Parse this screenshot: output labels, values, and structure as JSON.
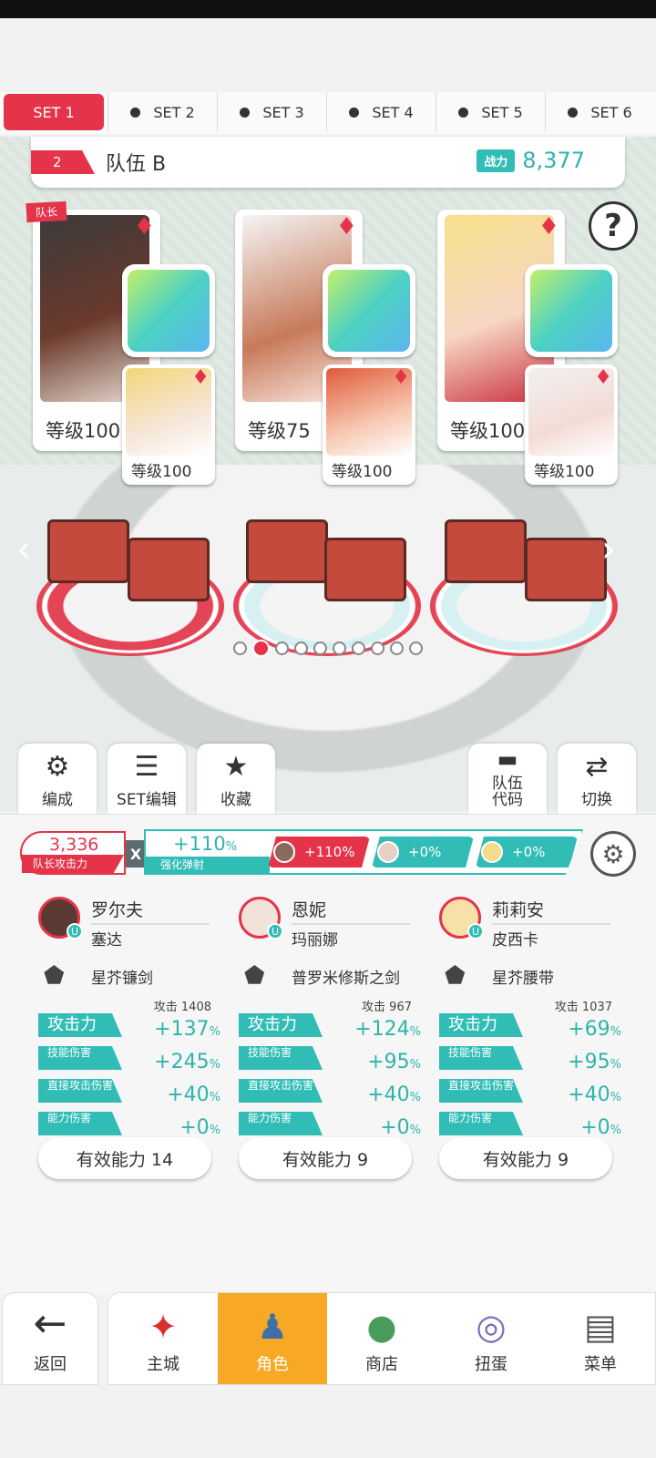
{
  "set_tabs": [
    {
      "label": "SET 1",
      "active": true
    },
    {
      "label": "SET 2",
      "active": false
    },
    {
      "label": "SET 3",
      "active": false
    },
    {
      "label": "SET 4",
      "active": false
    },
    {
      "label": "SET 5",
      "active": false
    },
    {
      "label": "SET 6",
      "active": false
    }
  ],
  "team": {
    "number": "2",
    "name": "队伍 B",
    "power_label": "战力",
    "power_value": "8,377"
  },
  "help_glyph": "?",
  "leader_label": "队长",
  "cards": [
    {
      "level": "等级100",
      "sub_level": "等级100"
    },
    {
      "level": "等级75",
      "sub_level": "等级100"
    },
    {
      "level": "等级100",
      "sub_level": "等级100"
    }
  ],
  "page_dots": {
    "total": 10,
    "active_index": 1
  },
  "side_buttons": [
    {
      "label": "编成",
      "icon": "person-gear-icon"
    },
    {
      "label": "SET编辑",
      "icon": "list-icon"
    },
    {
      "label": "收藏",
      "icon": "thumbs-up-star-icon"
    },
    {
      "label": "队伍\n代码",
      "icon": "chat-bubble-icon"
    },
    {
      "label": "切换",
      "icon": "swap-icon"
    }
  ],
  "leader_attack": {
    "value": "3,336",
    "label": "队长攻击力"
  },
  "multiplier": "X",
  "boost": {
    "value": "+110",
    "unit": "%",
    "label": "强化弹射"
  },
  "chips": [
    {
      "value": "+110%",
      "color": "#e5344a"
    },
    {
      "value": "+0%",
      "color": "#31bdb6"
    },
    {
      "value": "+0%",
      "color": "#31bdb6"
    }
  ],
  "heroes": [
    {
      "name": "罗尔夫",
      "sub": "塞达",
      "weapon": "星芥镰剑",
      "attack_raw": "攻击 1408",
      "stats": [
        {
          "label": "攻击力",
          "value": "+137",
          "unit": "%"
        },
        {
          "label": "技能伤害",
          "value": "+245",
          "unit": "%"
        },
        {
          "label": "直接攻击伤害",
          "value": "+40",
          "unit": "%"
        },
        {
          "label": "能力伤害",
          "value": "+0",
          "unit": "%"
        }
      ],
      "effective": "有效能力 14"
    },
    {
      "name": "恩妮",
      "sub": "玛丽娜",
      "weapon": "普罗米修斯之剑",
      "attack_raw": "攻击  967",
      "stats": [
        {
          "label": "攻击力",
          "value": "+124",
          "unit": "%"
        },
        {
          "label": "技能伤害",
          "value": "+95",
          "unit": "%"
        },
        {
          "label": "直接攻击伤害",
          "value": "+40",
          "unit": "%"
        },
        {
          "label": "能力伤害",
          "value": "+0",
          "unit": "%"
        }
      ],
      "effective": "有效能力 9"
    },
    {
      "name": "莉莉安",
      "sub": "皮西卡",
      "weapon": "星芥腰带",
      "attack_raw": "攻击 1037",
      "stats": [
        {
          "label": "攻击力",
          "value": "+69",
          "unit": "%"
        },
        {
          "label": "技能伤害",
          "value": "+95",
          "unit": "%"
        },
        {
          "label": "直接攻击伤害",
          "value": "+40",
          "unit": "%"
        },
        {
          "label": "能力伤害",
          "value": "+0",
          "unit": "%"
        }
      ],
      "effective": "有效能力 9"
    }
  ],
  "nav": {
    "back": "返回",
    "items": [
      {
        "label": "主城",
        "active": false
      },
      {
        "label": "角色",
        "active": true
      },
      {
        "label": "商店",
        "active": false
      },
      {
        "label": "扭蛋",
        "active": false
      },
      {
        "label": "菜单",
        "active": false
      }
    ]
  },
  "colors": {
    "accent_red": "#e5344a",
    "accent_teal": "#31bdb6",
    "nav_active": "#f7a825"
  }
}
